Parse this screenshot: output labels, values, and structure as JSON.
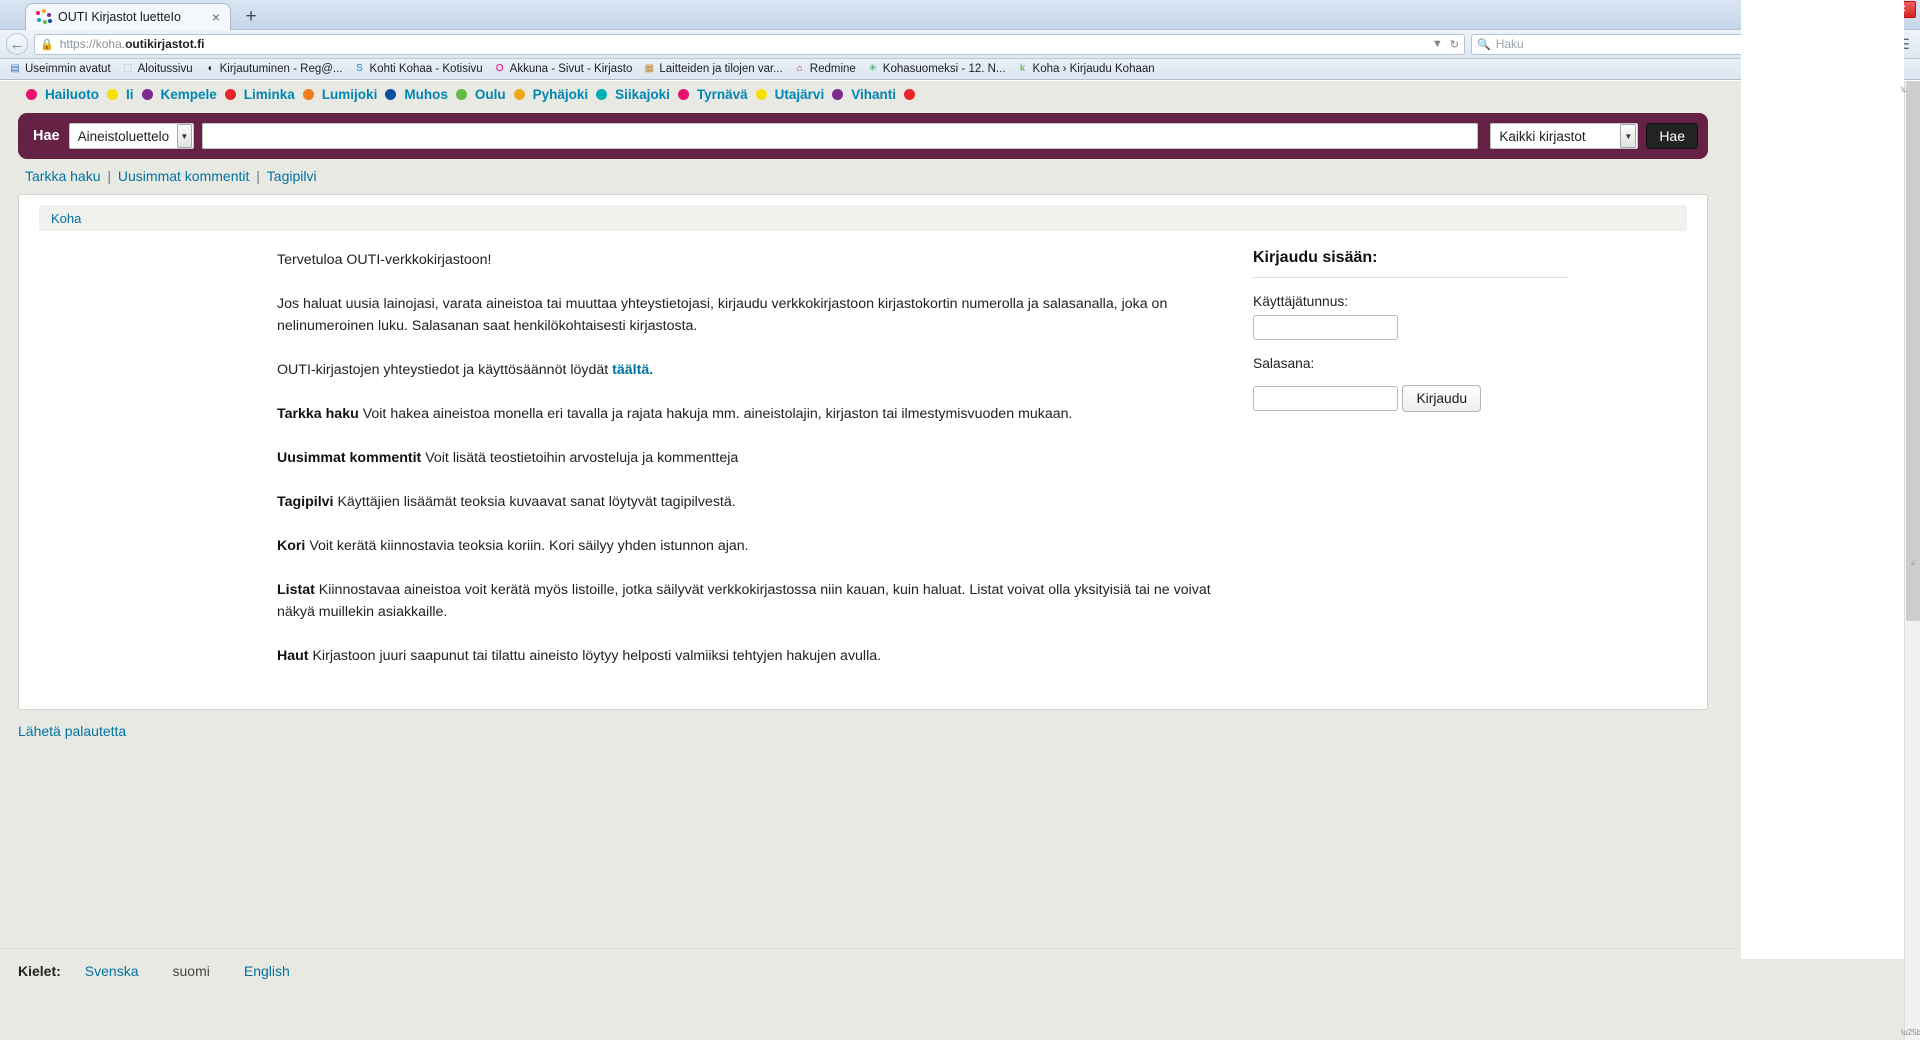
{
  "browser": {
    "tab": {
      "title": "OUTI Kirjastot luetteIo",
      "close": "×"
    },
    "newtab": "+",
    "window_controls": {
      "minimize": "—",
      "maximize": "❐",
      "close": "✕"
    },
    "nav": {
      "back": "←",
      "lock": "🔒",
      "url_scheme": "https://koha.",
      "url_domain": "outikirjastot.fi",
      "url_dropdown": "▼",
      "reload": "↻",
      "search_placeholder": "Haku",
      "search_icon": "🔍",
      "bookmark_star": "☆",
      "reading_list": "☰",
      "download": "⬇",
      "home": "⌂",
      "menu": "☰"
    },
    "bookmarks": [
      {
        "label": "Useimmin avatut",
        "glyph": "▤",
        "color": "#3a76c4"
      },
      {
        "label": "Aloitussivu",
        "glyph": "⬚",
        "color": "#999999"
      },
      {
        "label": "Kirjautuminen - Reg@...",
        "glyph": "◖",
        "color": "#101010"
      },
      {
        "label": "Kohti Kohaa - Kotisivu",
        "glyph": "S",
        "color": "#1e88e5"
      },
      {
        "label": "Akkuna - Sivut - Kirjasto",
        "glyph": "O",
        "color": "#e5007d"
      },
      {
        "label": "Laitteiden ja tilojen var...",
        "glyph": "▦",
        "color": "#c08a2e"
      },
      {
        "label": "Redmine",
        "glyph": "⌂",
        "color": "#cc3333"
      },
      {
        "label": "Kohasuomeksi - 12. N...",
        "glyph": "✳",
        "color": "#3aa856"
      },
      {
        "label": "Koha › Kirjaudu Kohaan",
        "glyph": "k",
        "color": "#5aa83c"
      }
    ]
  },
  "site": {
    "libraries": [
      {
        "name": "Hailuoto",
        "color": "#e8136f"
      },
      {
        "name": "Ii",
        "color": "#f5e000"
      },
      {
        "name": "Kempele",
        "color": "#7b2a8f"
      },
      {
        "name": "Liminka",
        "color": "#e8252a"
      },
      {
        "name": "Lumijoki",
        "color": "#ef7d1a"
      },
      {
        "name": "Muhos",
        "color": "#0b4fa0"
      },
      {
        "name": "Oulu",
        "color": "#63bb46"
      },
      {
        "name": "Pyhäjoki",
        "color": "#f0a81c"
      },
      {
        "name": "Siikajoki",
        "color": "#00b0b9"
      },
      {
        "name": "Tyrnävä",
        "color": "#e8136f"
      },
      {
        "name": "Utajärvi",
        "color": "#f5e000"
      },
      {
        "name": "Vihanti",
        "color": "#7b2a8f"
      },
      {
        "name": "",
        "color": "#e8252a"
      }
    ],
    "search": {
      "label": "Hae",
      "type_selected": "Aineistoluettelo",
      "query_value": "",
      "library_selected": "Kaikki kirjastot",
      "submit_label": "Hae",
      "dropdown_arrow": "▼",
      "accent_color": "#662244"
    },
    "sublinks": [
      {
        "label": "Tarkka haku"
      },
      {
        "label": "Uusimmat kommentit"
      },
      {
        "label": "Tagipilvi"
      }
    ],
    "sublink_separator": "|",
    "breadcrumb": "Koha",
    "content": {
      "p_welcome": "Tervetuloa OUTI-verkkokirjastoon!",
      "p_intro": "Jos haluat uusia lainojasi, varata aineistoa tai muuttaa yhteystietojasi, kirjaudu verkkokirjastoon kirjastokortin numerolla ja salasanalla, joka on nelinumeroinen luku. Salasanan saat henkilökohtaisesti kirjastosta.",
      "p_contact_pre": "OUTI-kirjastojen yhteystiedot ja käyttösäännöt löydät ",
      "p_contact_link": "täältä.",
      "items": [
        {
          "term": "Tarkka haku",
          "desc": " Voit hakea aineistoa monella eri tavalla ja rajata hakuja mm. aineistolajin, kirjaston tai ilmestymisvuoden mukaan."
        },
        {
          "term": "Uusimmat kommentit",
          "desc": " Voit lisätä teostietoihin arvosteluja ja kommentteja"
        },
        {
          "term": "Tagipilvi",
          "desc": " Käyttäjien lisäämät teoksia kuvaavat sanat löytyvät tagipilvestä."
        },
        {
          "term": "Kori",
          "desc": " Voit kerätä kiinnostavia teoksia koriin. Kori säilyy yhden istunnon ajan."
        },
        {
          "term": "Listat",
          "desc": " Kiinnostavaa aineistoa voit kerätä myös listoille, jotka säilyvät verkkokirjastossa niin kauan, kuin haluat. Listat voivat olla yksityisiä tai ne voivat näkyä muillekin asiakkaille."
        },
        {
          "term": "Haut",
          "desc": " Kirjastoon juuri saapunut tai tilattu aineisto löytyy helposti valmiiksi tehtyjen hakujen avulla."
        }
      ]
    },
    "login": {
      "title": "Kirjaudu sisään:",
      "username_label": "Käyttäjätunnus:",
      "username_value": "",
      "password_label": "Salasana:",
      "password_value": "",
      "submit_label": "Kirjaudu"
    },
    "feedback_link": "Lähetä palautetta",
    "languages": {
      "label": "Kielet:",
      "options": [
        {
          "label": "Svenska",
          "active": true
        },
        {
          "label": "suomi",
          "active": false
        },
        {
          "label": "English",
          "active": true
        }
      ]
    }
  }
}
